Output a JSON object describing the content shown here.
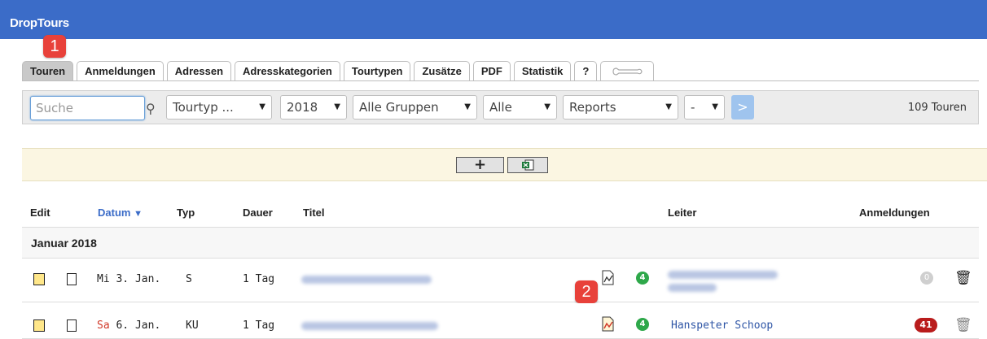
{
  "app": {
    "title": "DropTours"
  },
  "markers": {
    "m1": "1",
    "m2": "2"
  },
  "tabs": [
    "Touren",
    "Anmeldungen",
    "Adressen",
    "Adresskategorien",
    "Tourtypen",
    "Zusätze",
    "PDF",
    "Statistik",
    "?"
  ],
  "tab_tools_icon": "tools-icon",
  "filter": {
    "search_placeholder": "Suche",
    "tourtyp": "Tourtyp ...",
    "year": "2018",
    "groups": "Alle Gruppen",
    "scope": "Alle",
    "reports": "Reports",
    "dash": "-",
    "go": ">",
    "count": "109 Touren"
  },
  "actions": {
    "add": "+",
    "excel_icon": "excel-icon"
  },
  "columns": {
    "edit": "Edit",
    "date": "Datum",
    "type": "Typ",
    "duration": "Dauer",
    "title": "Titel",
    "leader": "Leiter",
    "registrations": "Anmeldungen"
  },
  "group": "Januar 2018",
  "rows": [
    {
      "weekday": "Mi",
      "date": "3. Jan.",
      "type": "S",
      "duration": "1 Tag",
      "registrations": "0",
      "status": "4",
      "leader": ""
    },
    {
      "weekday": "Sa",
      "date": "6. Jan.",
      "type": "KU",
      "duration": "1 Tag",
      "registrations": "41",
      "status": "4",
      "leader": "Hanspeter Schoop"
    }
  ],
  "colors": {
    "brand": "#3b6cc8",
    "marker": "#e8413a",
    "badge_red": "#b91c1c",
    "badge_green": "#2ea84a"
  }
}
